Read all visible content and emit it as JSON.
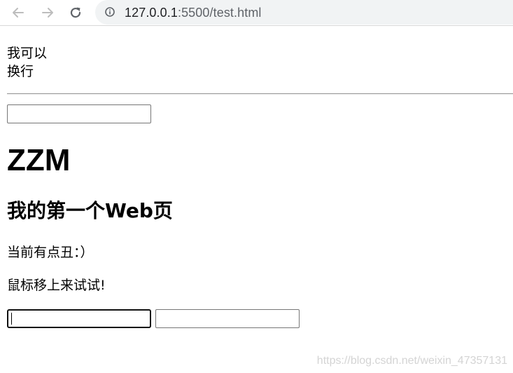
{
  "browser": {
    "url_host": "127.0.0.1",
    "url_rest": ":5500/test.html"
  },
  "page": {
    "line1": "我可以",
    "line2": "换行",
    "heading1": "ZZM",
    "heading2": "我的第一个Web页",
    "paragraph1": "当前有点丑：）",
    "paragraph2": "鼠标移上来试试!",
    "watermark": "https://blog.csdn.net/weixin_47357131"
  },
  "colors": {
    "address_bar_bg": "#f1f3f4",
    "nav_icon": "#5f6368",
    "watermark": "#d4d4d4"
  },
  "icons": {
    "back": "back-arrow-icon",
    "forward": "forward-arrow-icon",
    "reload": "reload-icon",
    "info": "info-icon"
  }
}
